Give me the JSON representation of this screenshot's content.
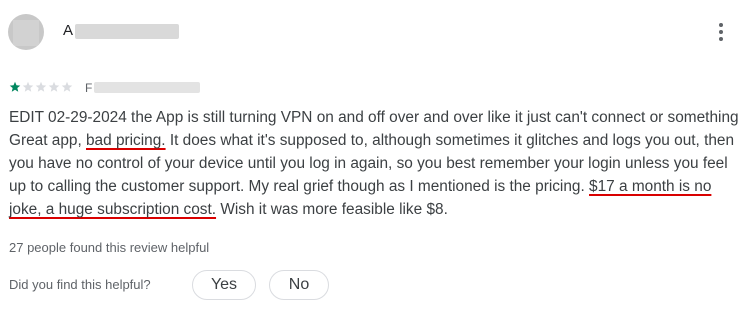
{
  "review": {
    "author_visible": "A",
    "date_visible": "F",
    "rating": 1,
    "rating_max": 5,
    "body": {
      "p1": "EDIT 02-29-2024 the App is still turning VPN on and off over and over like it just can't connect or something Great app, ",
      "hl1": "bad pricing.",
      "p2": " It does what it's supposed to, although sometimes it glitches and logs you out, then you have no control of your device until you log in again, so you best remember your login unless you feel up to calling the customer support. My real grief though as I mentioned is the pricing. ",
      "hl2": "$17 a month is no joke, a huge subscription cost.",
      "p3": " Wish it was more feasible like $8."
    },
    "helpful_count_text": "27 people found this review helpful",
    "helpful_question": "Did you find this helpful?",
    "yes_label": "Yes",
    "no_label": "No"
  },
  "icons": {
    "more": "more-vert-icon",
    "star": "star-icon"
  },
  "colors": {
    "star_filled": "#01875f",
    "star_empty": "#dadce0",
    "underline": "#d90000",
    "text": "#3c4043",
    "muted": "#5f6368"
  }
}
